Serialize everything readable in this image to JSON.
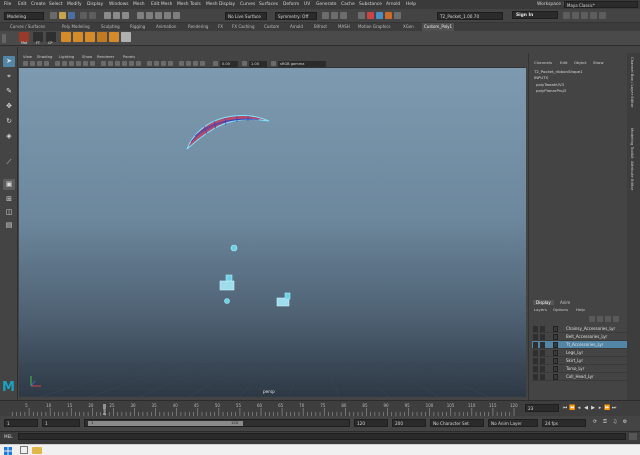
{
  "menubar": {
    "items": [
      "File",
      "Edit",
      "Create",
      "Select",
      "Modify",
      "Display",
      "Windows",
      "Mesh",
      "Edit Mesh",
      "Mesh Tools",
      "Mesh Display",
      "Curves",
      "Surfaces",
      "Deform",
      "UV",
      "Generate",
      "Cache",
      "Substance",
      "Arnold",
      "Help"
    ],
    "workspace_label": "Workspace :",
    "workspace_value": "Maya Classic*"
  },
  "statusline": {
    "mode": "Modeling",
    "no_live_surface": "No Live Surface",
    "symmetry": "Symmetry: Off",
    "scene_name": "T2_Pocket_1.00.70",
    "sign_in": "Sign In"
  },
  "shelf": {
    "tabs": [
      "Curves / Surfaces",
      "Poly Modeling",
      "Sculpting",
      "Rigging",
      "Animation",
      "Rendering",
      "FX",
      "FX Caching",
      "Custom",
      "Arnold",
      "Bifrost",
      "MASH",
      "Motion Graphics",
      "XGen",
      "Custom_Poly1"
    ],
    "active_tab": "Custom_Poly1",
    "button_labels": [
      "Mat",
      "FT",
      "CP"
    ]
  },
  "viewport": {
    "panel_menus": [
      "View",
      "Shading",
      "Lighting",
      "Show",
      "Renderer",
      "Panels"
    ],
    "exposure": "0.00",
    "gamma": "1.00",
    "color_space": "sRGB gamma",
    "camera_label": "persp"
  },
  "channel_box": {
    "menus": [
      "Channels",
      "Edit",
      "Object",
      "Show"
    ],
    "object_name": "T2_Pocket_ribbonShape1",
    "inputs_heading": "INPUTS",
    "inputs": [
      "polyTweakUV3",
      "polyPlanarProj3"
    ]
  },
  "side_tabs": [
    "Channel Box / Layer Editor",
    "Modeling Toolkit",
    "Attribute Editor"
  ],
  "layer_editor": {
    "tabs": [
      "Display",
      "Anim"
    ],
    "active_tab": "Display",
    "menus": [
      "Layers",
      "Options",
      "Help"
    ],
    "layers": [
      {
        "name": "Chainsy_Accessories_Lyr",
        "selected": false
      },
      {
        "name": "Belt_Accessories_Lyr",
        "selected": false
      },
      {
        "name": "Tt_Accessories_Lyr",
        "selected": true
      },
      {
        "name": "Legs_Lyr",
        "selected": false
      },
      {
        "name": "Skirt_Lyr",
        "selected": false
      },
      {
        "name": "Torso_Lyr",
        "selected": false
      },
      {
        "name": "Coll_Head_Lyr",
        "selected": false
      }
    ]
  },
  "time_slider": {
    "ticks": [
      "5",
      "10",
      "15",
      "20",
      "25",
      "30",
      "35",
      "40",
      "45",
      "50",
      "55",
      "60",
      "65",
      "70",
      "75",
      "80",
      "85",
      "90",
      "95",
      "100",
      "105",
      "110",
      "115",
      "120"
    ],
    "current_frame": "23",
    "current_marker": "23"
  },
  "range_slider": {
    "start": "1",
    "start_inner": "1",
    "range_start_label": "1",
    "range_end_label": "120",
    "end_inner": "120",
    "end": "200",
    "character_set": "No Character Set",
    "anim_layer": "No Anim Layer",
    "fps": "24 fps"
  },
  "command_line": {
    "label": "MEL"
  },
  "colors": {
    "selection_blue": "#5285a6",
    "maya_logo": "#19a3c2"
  }
}
